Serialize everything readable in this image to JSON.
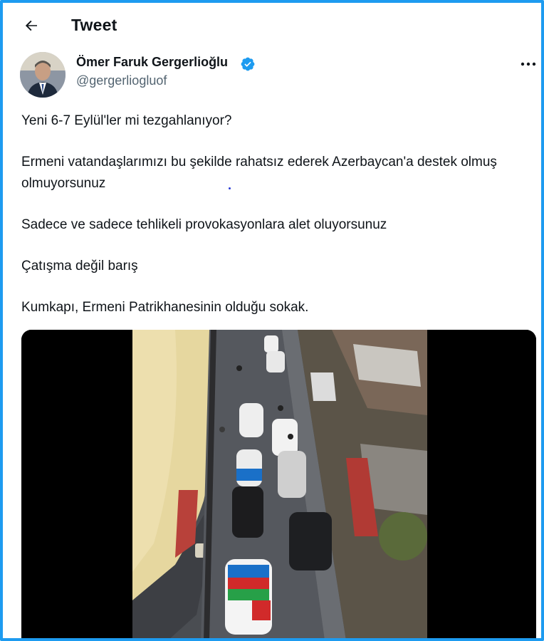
{
  "header": {
    "title": "Tweet",
    "back_icon": "arrow-left-icon"
  },
  "author": {
    "name": "Ömer Faruk Gergerlioğlu",
    "handle": "@gergerliogluof",
    "verified": true,
    "verified_color": "#1d9bf0",
    "more_icon": "more-horizontal-icon"
  },
  "tweet": {
    "paragraphs": [
      "Yeni 6-7 Eylül'ler mi tezgahlanıyor?",
      "Ermeni vatandaşlarımızı bu şekilde rahatsız ederek Azerbaycan'a destek olmuş olmuyorsunuz",
      "Sadece ve sadece tehlikeli provokasyonlara alet oluyorsunuz",
      "Çatışma değil barış",
      "Kumkapı, Ermeni Patrikhanesinin olduğu sokak."
    ]
  },
  "media": {
    "type": "video",
    "scene": "aerial-street-cars-with-flags"
  },
  "colors": {
    "accent": "#1d9bf0",
    "text": "#0f1419",
    "secondary_text": "#536471"
  }
}
